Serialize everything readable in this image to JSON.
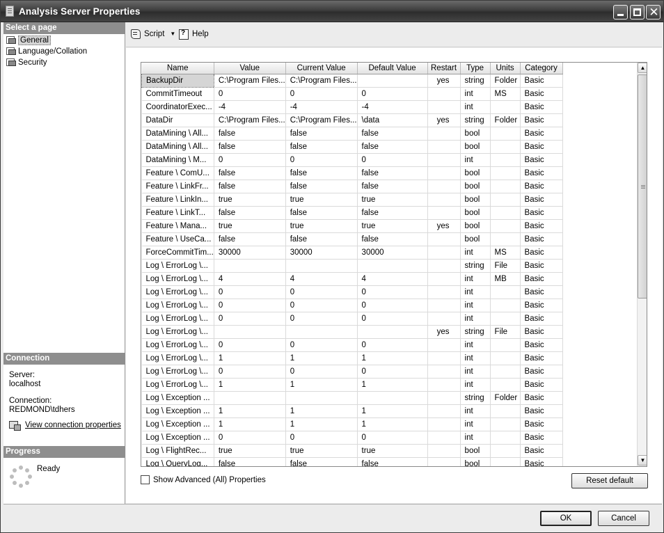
{
  "window": {
    "title": "Analysis Server Properties"
  },
  "left": {
    "select_page_header": "Select a page",
    "pages": [
      {
        "label": "General",
        "selected": true,
        "icon": "page-icon"
      },
      {
        "label": "Language/Collation",
        "selected": false,
        "icon": "page-icon"
      },
      {
        "label": "Security",
        "selected": false,
        "icon": "page-icon"
      }
    ],
    "connection_header": "Connection",
    "server_label": "Server:",
    "server_value": "localhost",
    "connection_label": "Connection:",
    "connection_value": "REDMOND\\tdhers",
    "view_connection_link": "View connection properties",
    "progress_header": "Progress",
    "progress_status": "Ready"
  },
  "toolbar": {
    "script_label": "Script",
    "help_label": "Help"
  },
  "grid": {
    "columns": [
      "Name",
      "Value",
      "Current Value",
      "Default Value",
      "Restart",
      "Type",
      "Units",
      "Category"
    ],
    "rows": [
      [
        "BackupDir",
        "C:\\Program Files...",
        "C:\\Program Files...",
        "",
        "yes",
        "string",
        "Folder",
        "Basic"
      ],
      [
        "CommitTimeout",
        "0",
        "0",
        "0",
        "",
        "int",
        "MS",
        "Basic"
      ],
      [
        "CoordinatorExec...",
        "-4",
        "-4",
        "-4",
        "",
        "int",
        "",
        "Basic"
      ],
      [
        "DataDir",
        "C:\\Program Files...",
        "C:\\Program Files...",
        "\\data",
        "yes",
        "string",
        "Folder",
        "Basic"
      ],
      [
        "DataMining \\ All...",
        "false",
        "false",
        "false",
        "",
        "bool",
        "",
        "Basic"
      ],
      [
        "DataMining \\ All...",
        "false",
        "false",
        "false",
        "",
        "bool",
        "",
        "Basic"
      ],
      [
        "DataMining \\ M...",
        "0",
        "0",
        "0",
        "",
        "int",
        "",
        "Basic"
      ],
      [
        "Feature \\ ComU...",
        "false",
        "false",
        "false",
        "",
        "bool",
        "",
        "Basic"
      ],
      [
        "Feature \\ LinkFr...",
        "false",
        "false",
        "false",
        "",
        "bool",
        "",
        "Basic"
      ],
      [
        "Feature \\ LinkIn...",
        "true",
        "true",
        "true",
        "",
        "bool",
        "",
        "Basic"
      ],
      [
        "Feature \\ LinkT...",
        "false",
        "false",
        "false",
        "",
        "bool",
        "",
        "Basic"
      ],
      [
        "Feature \\ Mana...",
        "true",
        "true",
        "true",
        "yes",
        "bool",
        "",
        "Basic"
      ],
      [
        "Feature \\ UseCa...",
        "false",
        "false",
        "false",
        "",
        "bool",
        "",
        "Basic"
      ],
      [
        "ForceCommitTim...",
        "30000",
        "30000",
        "30000",
        "",
        "int",
        "MS",
        "Basic"
      ],
      [
        "Log \\ ErrorLog \\...",
        "",
        "",
        "",
        "",
        "string",
        "File",
        "Basic"
      ],
      [
        "Log \\ ErrorLog \\...",
        "4",
        "4",
        "4",
        "",
        "int",
        "MB",
        "Basic"
      ],
      [
        "Log \\ ErrorLog \\...",
        "0",
        "0",
        "0",
        "",
        "int",
        "",
        "Basic"
      ],
      [
        "Log \\ ErrorLog \\...",
        "0",
        "0",
        "0",
        "",
        "int",
        "",
        "Basic"
      ],
      [
        "Log \\ ErrorLog \\...",
        "0",
        "0",
        "0",
        "",
        "int",
        "",
        "Basic"
      ],
      [
        "Log \\ ErrorLog \\...",
        "",
        "",
        "",
        "yes",
        "string",
        "File",
        "Basic"
      ],
      [
        "Log \\ ErrorLog \\...",
        "0",
        "0",
        "0",
        "",
        "int",
        "",
        "Basic"
      ],
      [
        "Log \\ ErrorLog \\...",
        "1",
        "1",
        "1",
        "",
        "int",
        "",
        "Basic"
      ],
      [
        "Log \\ ErrorLog \\...",
        "0",
        "0",
        "0",
        "",
        "int",
        "",
        "Basic"
      ],
      [
        "Log \\ ErrorLog \\...",
        "1",
        "1",
        "1",
        "",
        "int",
        "",
        "Basic"
      ],
      [
        "Log \\ Exception ...",
        "",
        "",
        "",
        "",
        "string",
        "Folder",
        "Basic"
      ],
      [
        "Log \\ Exception ...",
        "1",
        "1",
        "1",
        "",
        "int",
        "",
        "Basic"
      ],
      [
        "Log \\ Exception ...",
        "1",
        "1",
        "1",
        "",
        "int",
        "",
        "Basic"
      ],
      [
        "Log \\ Exception ...",
        "0",
        "0",
        "0",
        "",
        "int",
        "",
        "Basic"
      ],
      [
        "Log \\ FlightRec...",
        "true",
        "true",
        "true",
        "",
        "bool",
        "",
        "Basic"
      ],
      [
        "Log \\ QueryLog...",
        "false",
        "false",
        "false",
        "",
        "bool",
        "",
        "Basic"
      ]
    ]
  },
  "options": {
    "show_advanced_label": "Show Advanced (All) Properties",
    "show_advanced_checked": false
  },
  "buttons": {
    "reset_default": "Reset default",
    "ok": "OK",
    "cancel": "Cancel"
  }
}
